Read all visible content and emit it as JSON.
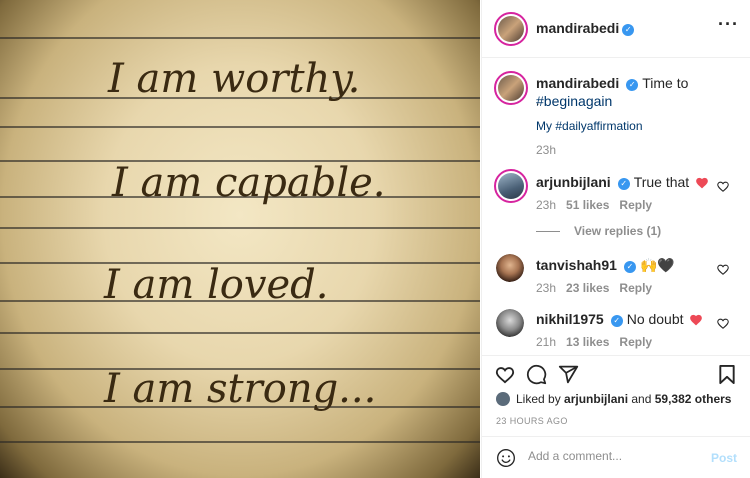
{
  "photo": {
    "lines": [
      "I am worthy.",
      "I am capable.",
      "I am loved.",
      "I am strong..."
    ]
  },
  "header": {
    "username": "mandirabedi",
    "more_icon": "more-horizontal-icon"
  },
  "caption": {
    "username": "mandirabedi",
    "text_prefix": "Time to ",
    "hashtag1": "#beginagain",
    "dot": ".",
    "line2_prefix": "My ",
    "hashtag2": "#dailyaffirmation",
    "time": "23h"
  },
  "comments": [
    {
      "username": "arjunbijlani",
      "verified": true,
      "text": "True that",
      "time": "23h",
      "likes": "51 likes",
      "reply": "Reply",
      "view_replies": "View replies (1)"
    },
    {
      "username": "tanvishah91",
      "verified": true,
      "text": "🙌🖤",
      "time": "23h",
      "likes": "23 likes",
      "reply": "Reply"
    },
    {
      "username": "nikhil1975",
      "verified": true,
      "text": "No doubt",
      "time": "21h",
      "likes": "13 likes",
      "reply": "Reply"
    }
  ],
  "likes": {
    "prefix": "Liked by ",
    "user": "arjunbijlani",
    "and": " and ",
    "others": "59,382 others"
  },
  "timestamp": "23 HOURS AGO",
  "add_comment": {
    "placeholder": "Add a comment...",
    "post_label": "Post"
  },
  "colors": {
    "verified": "#3897f0",
    "heart_red": "#ed4956",
    "post_disabled": "#b2dffc",
    "hashtag": "#00376b"
  }
}
